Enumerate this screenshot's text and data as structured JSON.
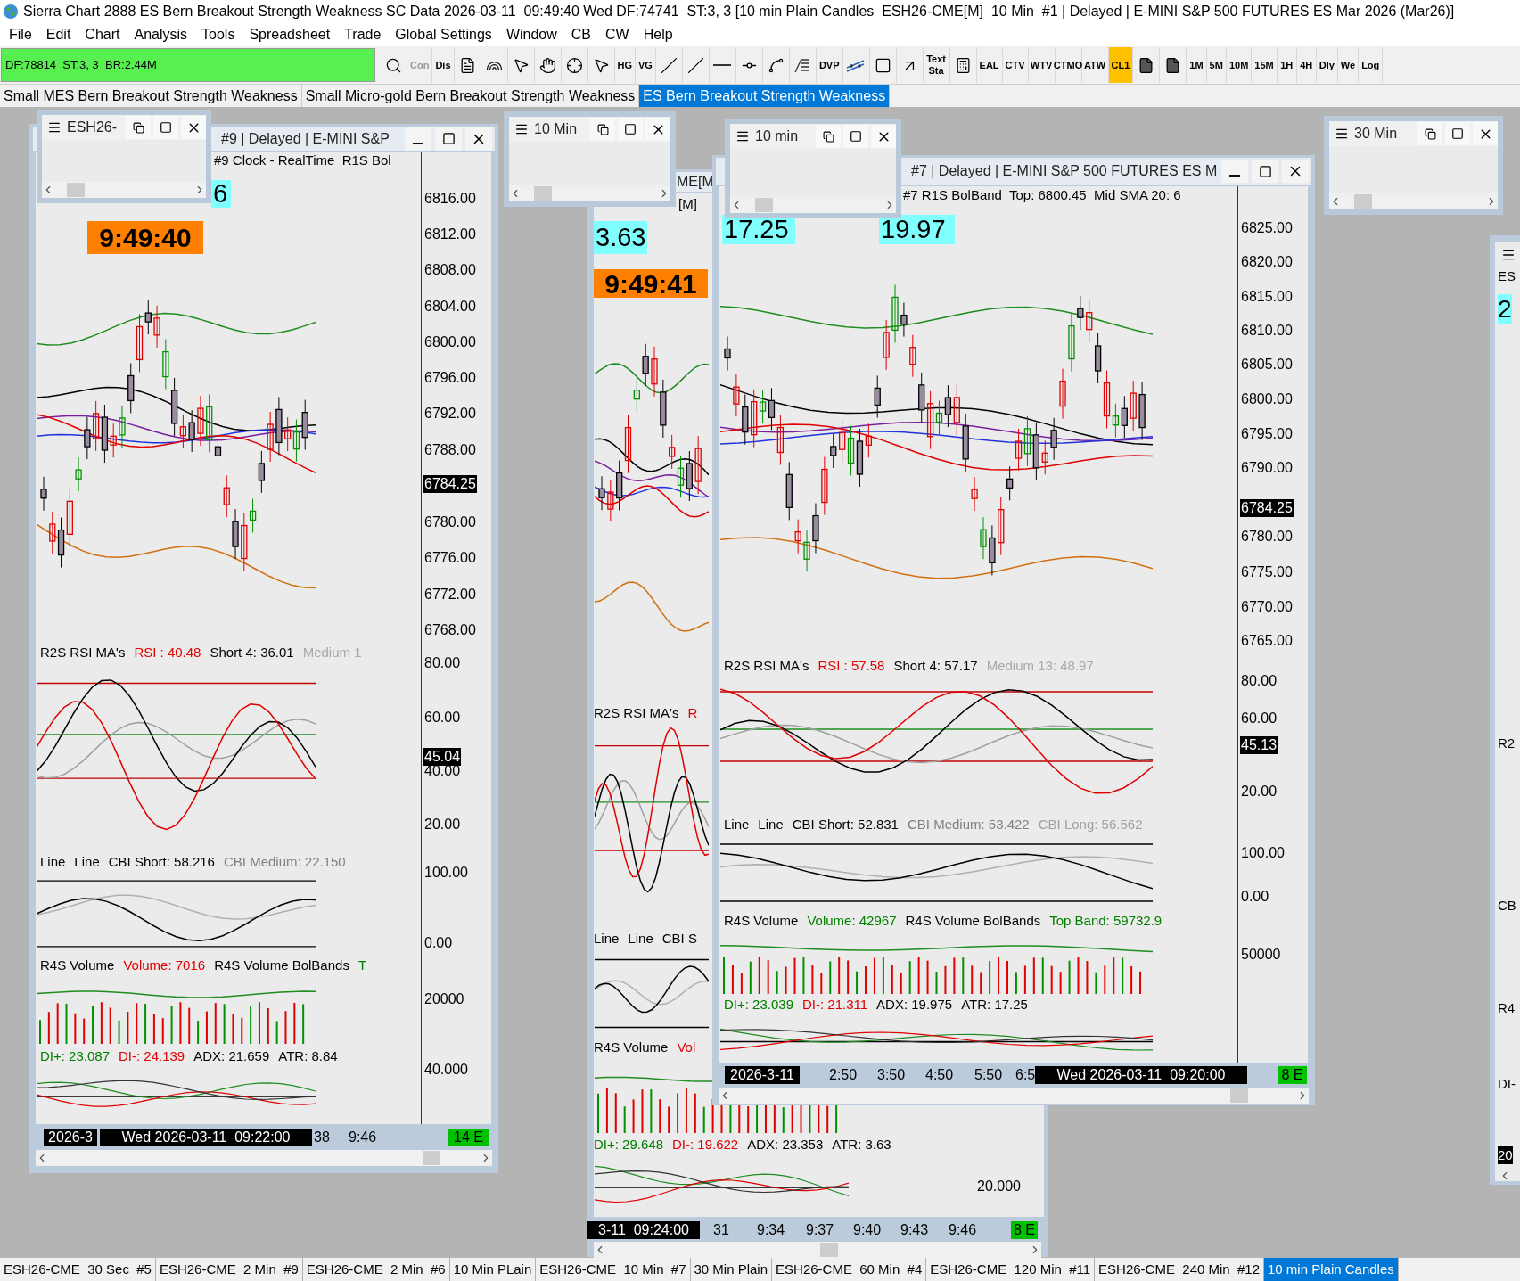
{
  "window": {
    "title": "Sierra Chart 2888 ES Bern Breakout Strength Weakness SC Data 2026-03-11  09:49:40 Wed DF:74741  ST:3, 3 [10 min Plain Candles  ESH26-CME[M]  10 Min  #1 | Delayed | E-MINI S&P 500 FUTURES ES Mar 2026 (Mar26)]"
  },
  "menu": [
    "File",
    "Edit",
    "Chart",
    "Analysis",
    "Tools",
    "Spreadsheet",
    "Trade",
    "Global Settings",
    "Window",
    "CB",
    "CW",
    "Help"
  ],
  "toolbar": {
    "status": "DF:78814  ST:3, 3  BR:2.44M",
    "items": [
      {
        "kind": "icon",
        "selected": false,
        "disabled": false
      },
      {
        "kind": "text",
        "label": "Con",
        "selected": false,
        "disabled": true
      },
      {
        "kind": "text",
        "label": "Dis",
        "selected": false,
        "disabled": false
      },
      {
        "kind": "icon",
        "selected": false,
        "disabled": false
      },
      {
        "kind": "icon",
        "selected": false,
        "disabled": false
      },
      {
        "kind": "icon",
        "selected": false,
        "disabled": false
      },
      {
        "kind": "icon",
        "selected": false,
        "disabled": false
      },
      {
        "kind": "icon",
        "selected": false,
        "disabled": false
      },
      {
        "kind": "icon",
        "selected": false,
        "disabled": false
      },
      {
        "kind": "text",
        "label": "HG",
        "selected": false,
        "disabled": false
      },
      {
        "kind": "text",
        "label": "VG",
        "selected": false,
        "disabled": false
      },
      {
        "kind": "icon",
        "selected": false,
        "disabled": false
      },
      {
        "kind": "icon",
        "selected": false,
        "disabled": false
      },
      {
        "kind": "icon",
        "selected": false,
        "disabled": false
      },
      {
        "kind": "icon",
        "selected": false,
        "disabled": false
      },
      {
        "kind": "icon",
        "selected": false,
        "disabled": false
      },
      {
        "kind": "icon",
        "selected": false,
        "disabled": false
      },
      {
        "kind": "text",
        "label": "DVP",
        "selected": false,
        "disabled": false
      },
      {
        "kind": "icon",
        "selected": false,
        "disabled": false
      },
      {
        "kind": "icon",
        "selected": false,
        "disabled": false
      },
      {
        "kind": "icon",
        "selected": false,
        "disabled": false
      },
      {
        "kind": "text",
        "label": "Text Sta",
        "selected": false,
        "disabled": false
      },
      {
        "kind": "icon",
        "selected": false,
        "disabled": false
      },
      {
        "kind": "text",
        "label": "EAL",
        "selected": false,
        "disabled": false
      },
      {
        "kind": "text",
        "label": "CTV",
        "selected": false,
        "disabled": false
      },
      {
        "kind": "text",
        "label": "WTV",
        "selected": false,
        "disabled": false
      },
      {
        "kind": "text",
        "label": "CTMO",
        "selected": false,
        "disabled": false
      },
      {
        "kind": "text",
        "label": "ATW",
        "selected": false,
        "disabled": false
      },
      {
        "kind": "text",
        "label": "CL1",
        "selected": true,
        "disabled": false
      },
      {
        "kind": "icon",
        "selected": false,
        "disabled": false
      },
      {
        "kind": "icon",
        "selected": false,
        "disabled": false
      },
      {
        "kind": "text",
        "label": "1M",
        "selected": false,
        "disabled": false
      },
      {
        "kind": "text",
        "label": "5M",
        "selected": false,
        "disabled": false
      },
      {
        "kind": "text",
        "label": "10M",
        "selected": false,
        "disabled": false
      },
      {
        "kind": "text",
        "label": "15M",
        "selected": false,
        "disabled": false
      },
      {
        "kind": "text",
        "label": "1H",
        "selected": false,
        "disabled": false
      },
      {
        "kind": "text",
        "label": "4H",
        "selected": false,
        "disabled": false
      },
      {
        "kind": "text",
        "label": "Dly",
        "selected": false,
        "disabled": false
      },
      {
        "kind": "text",
        "label": "We",
        "selected": false,
        "disabled": false
      },
      {
        "kind": "text",
        "label": "Log",
        "selected": false,
        "disabled": false
      }
    ]
  },
  "chartbook_tabs": [
    {
      "label": "Small MES Bern Breakout Strength Weakness",
      "selected": false
    },
    {
      "label": "Small Micro-gold Bern Breakout Strength Weakness",
      "selected": false
    },
    {
      "label": "ES Bern Breakout Strength Weakness",
      "selected": true
    }
  ],
  "chart_windows": [
    {
      "title": "#9 | Delayed | E-MINI S&P",
      "chart_header": "#9 Clock - RealTime  R1S Bol",
      "value_boxes": [
        {
          "text": "6",
          "kind": "value"
        },
        {
          "text": "9:49:40",
          "kind": "clock"
        }
      ],
      "panels": [
        {
          "items": [
            {
              "text": "R2S RSI MA's",
              "color": "#000000"
            },
            {
              "text": "RSI : 40.48",
              "color": "#e00000"
            },
            {
              "text": "Short 4: 36.01",
              "color": "#000000"
            },
            {
              "text": "Medium 1",
              "color": "#a8a8a8"
            }
          ]
        },
        {
          "items": [
            {
              "text": "Line",
              "color": "#000000"
            },
            {
              "text": "Line",
              "color": "#000000"
            },
            {
              "text": "CBI Short: 58.216",
              "color": "#000000"
            },
            {
              "text": "CBI Medium: 22.150",
              "color": "#808080"
            }
          ]
        },
        {
          "items": [
            {
              "text": "R4S Volume",
              "color": "#000000"
            },
            {
              "text": "Volume: 7016",
              "color": "#e00000"
            },
            {
              "text": "R4S Volume BolBands",
              "color": "#000000"
            },
            {
              "text": "T",
              "color": "#008000"
            }
          ]
        },
        {
          "items": [
            {
              "text": "DI+: 23.087",
              "color": "#008000"
            },
            {
              "text": "DI-: 24.139",
              "color": "#e00000"
            },
            {
              "text": "ADX: 21.659",
              "color": "#000000"
            },
            {
              "text": "ATR: 8.84",
              "color": "#000000"
            }
          ]
        }
      ],
      "price_axis": [
        {
          "label": "6816.00",
          "kind": "tick"
        },
        {
          "label": "6812.00",
          "kind": "tick"
        },
        {
          "label": "6808.00",
          "kind": "tick"
        },
        {
          "label": "6804.00",
          "kind": "tick"
        },
        {
          "label": "6800.00",
          "kind": "tick"
        },
        {
          "label": "6796.00",
          "kind": "tick"
        },
        {
          "label": "6792.00",
          "kind": "tick"
        },
        {
          "label": "6788.00",
          "kind": "tick"
        },
        {
          "label": "6784.25",
          "kind": "current"
        },
        {
          "label": "6780.00",
          "kind": "tick"
        },
        {
          "label": "6776.00",
          "kind": "tick"
        },
        {
          "label": "6772.00",
          "kind": "tick"
        },
        {
          "label": "6768.00",
          "kind": "tick"
        },
        {
          "label": "80.00",
          "kind": "tick"
        },
        {
          "label": "60.00",
          "kind": "tick"
        },
        {
          "label": "45.04",
          "kind": "current"
        },
        {
          "label": "40.00",
          "kind": "tick"
        },
        {
          "label": "20.00",
          "kind": "tick"
        },
        {
          "label": "100.00",
          "kind": "tick"
        },
        {
          "label": "0.00",
          "kind": "tick"
        },
        {
          "label": "20000",
          "kind": "tick"
        },
        {
          "label": "40.000",
          "kind": "tick"
        }
      ],
      "time_axis": [
        {
          "label": "2026-3",
          "kind": "cursor"
        },
        {
          "label": "Wed 2026-03-11  09:22:00",
          "kind": "cursor"
        },
        {
          "label": "38",
          "kind": "tick"
        },
        {
          "label": "9:46",
          "kind": "tick"
        },
        {
          "label": "14 E",
          "kind": "status"
        }
      ]
    },
    {
      "title": "ME[M",
      "chart_header": "[M]",
      "value_boxes": [
        {
          "text": "3.63",
          "kind": "value"
        },
        {
          "text": "9:49:41",
          "kind": "clock"
        }
      ],
      "panels": [
        {
          "items": [
            {
              "text": "R2S RSI MA's",
              "color": "#000000"
            },
            {
              "text": "R",
              "color": "#e00000"
            }
          ]
        },
        {
          "items": [
            {
              "text": "Line",
              "color": "#000000"
            },
            {
              "text": "Line",
              "color": "#000000"
            },
            {
              "text": "CBI S",
              "color": "#000000"
            }
          ]
        },
        {
          "items": [
            {
              "text": "R4S Volume",
              "color": "#000000"
            },
            {
              "text": "Vol",
              "color": "#e00000"
            }
          ]
        },
        {
          "items": [
            {
              "text": "DI+: 29.648",
              "color": "#008000"
            },
            {
              "text": "DI-: 19.622",
              "color": "#e00000"
            },
            {
              "text": "ADX: 23.353",
              "color": "#000000"
            },
            {
              "text": "ATR: 3.63",
              "color": "#000000"
            }
          ]
        }
      ],
      "price_axis": [
        {
          "label": "20.000",
          "kind": "tick"
        }
      ],
      "time_axis": [
        {
          "label": "3-11  09:24:00",
          "kind": "cursor"
        },
        {
          "label": "31",
          "kind": "tick"
        },
        {
          "label": "9:34",
          "kind": "tick"
        },
        {
          "label": "9:37",
          "kind": "tick"
        },
        {
          "label": "9:40",
          "kind": "tick"
        },
        {
          "label": "9:43",
          "kind": "tick"
        },
        {
          "label": "9:46",
          "kind": "tick"
        },
        {
          "label": "8 E",
          "kind": "status"
        }
      ]
    },
    {
      "title": "#7 | Delayed | E-MINI S&P 500 FUTURES ES M",
      "chart_header": "#7 R1S BolBand  Top: 6800.45  Mid SMA 20: 6",
      "value_boxes": [
        {
          "text": "17.25",
          "kind": "value"
        },
        {
          "text": "19.97",
          "kind": "value"
        }
      ],
      "panels": [
        {
          "items": [
            {
              "text": "R2S RSI MA's",
              "color": "#000000"
            },
            {
              "text": "RSI : 57.58",
              "color": "#e00000"
            },
            {
              "text": "Short 4: 57.17",
              "color": "#000000"
            },
            {
              "text": "Medium 13: 48.97",
              "color": "#a8a8a8"
            }
          ]
        },
        {
          "items": [
            {
              "text": "Line",
              "color": "#000000"
            },
            {
              "text": "Line",
              "color": "#000000"
            },
            {
              "text": "CBI Short: 52.831",
              "color": "#000000"
            },
            {
              "text": "CBI Medium: 53.422",
              "color": "#808080"
            },
            {
              "text": "CBI Long: 56.562",
              "color": "#a0a0a0"
            }
          ]
        },
        {
          "items": [
            {
              "text": "R4S Volume",
              "color": "#000000"
            },
            {
              "text": "Volume: 42967",
              "color": "#008000"
            },
            {
              "text": "R4S Volume BolBands",
              "color": "#000000"
            },
            {
              "text": "Top Band: 59732.9",
              "color": "#008000"
            }
          ]
        },
        {
          "items": [
            {
              "text": "DI+: 23.039",
              "color": "#008000"
            },
            {
              "text": "DI-: 21.311",
              "color": "#e00000"
            },
            {
              "text": "ADX: 19.975",
              "color": "#000000"
            },
            {
              "text": "ATR: 17.25",
              "color": "#000000"
            }
          ]
        }
      ],
      "price_axis": [
        {
          "label": "6825.00",
          "kind": "tick"
        },
        {
          "label": "6820.00",
          "kind": "tick"
        },
        {
          "label": "6815.00",
          "kind": "tick"
        },
        {
          "label": "6810.00",
          "kind": "tick"
        },
        {
          "label": "6805.00",
          "kind": "tick"
        },
        {
          "label": "6800.00",
          "kind": "tick"
        },
        {
          "label": "6795.00",
          "kind": "tick"
        },
        {
          "label": "6790.00",
          "kind": "tick"
        },
        {
          "label": "6784.25",
          "kind": "current"
        },
        {
          "label": "6780.00",
          "kind": "tick"
        },
        {
          "label": "6775.00",
          "kind": "tick"
        },
        {
          "label": "6770.00",
          "kind": "tick"
        },
        {
          "label": "6765.00",
          "kind": "tick"
        },
        {
          "label": "80.00",
          "kind": "tick"
        },
        {
          "label": "60.00",
          "kind": "tick"
        },
        {
          "label": "45.13",
          "kind": "current"
        },
        {
          "label": "20.00",
          "kind": "tick"
        },
        {
          "label": "100.00",
          "kind": "tick"
        },
        {
          "label": "0.00",
          "kind": "tick"
        },
        {
          "label": "50000",
          "kind": "tick"
        }
      ],
      "time_axis": [
        {
          "label": "2026-3-11",
          "kind": "cursor"
        },
        {
          "label": "2:50",
          "kind": "tick"
        },
        {
          "label": "3:50",
          "kind": "tick"
        },
        {
          "label": "4:50",
          "kind": "tick"
        },
        {
          "label": "5:50",
          "kind": "tick"
        },
        {
          "label": "6:5",
          "kind": "tick"
        },
        {
          "label": "Wed 2026-03-11  09:20:00",
          "kind": "cursor"
        },
        {
          "label": "8 E",
          "kind": "status"
        }
      ]
    }
  ],
  "small_windows": [
    {
      "title": "ESH26-"
    },
    {
      "title": "10 Min"
    },
    {
      "title": "10 min"
    },
    {
      "title": "30 Min"
    }
  ],
  "edge_window": {
    "labels": [
      {
        "text": "ES",
        "kind": "plain"
      },
      {
        "text": "2",
        "kind": "value"
      },
      {
        "text": "R2",
        "kind": "plain"
      },
      {
        "text": "CB",
        "kind": "plain"
      },
      {
        "text": "R4",
        "kind": "plain"
      },
      {
        "text": "DI-",
        "kind": "plain"
      },
      {
        "text": "20",
        "kind": "cursor"
      }
    ]
  },
  "bottom_tabs": [
    {
      "label": "ESH26-CME  30 Sec  #5",
      "selected": false
    },
    {
      "label": "ESH26-CME  2 Min  #9",
      "selected": false
    },
    {
      "label": "ESH26-CME  2 Min  #6",
      "selected": false
    },
    {
      "label": "10 Min PLain",
      "selected": false
    },
    {
      "label": "ESH26-CME  10 Min  #7",
      "selected": false
    },
    {
      "label": "30 Min Plain",
      "selected": false
    },
    {
      "label": "ESH26-CME  60 Min  #4",
      "selected": false
    },
    {
      "label": "ESH26-CME  120 Min  #11",
      "selected": false
    },
    {
      "label": "ESH26-CME  240 Min  #12",
      "selected": false
    },
    {
      "label": "10 min Plain Candles",
      "selected": true
    }
  ]
}
